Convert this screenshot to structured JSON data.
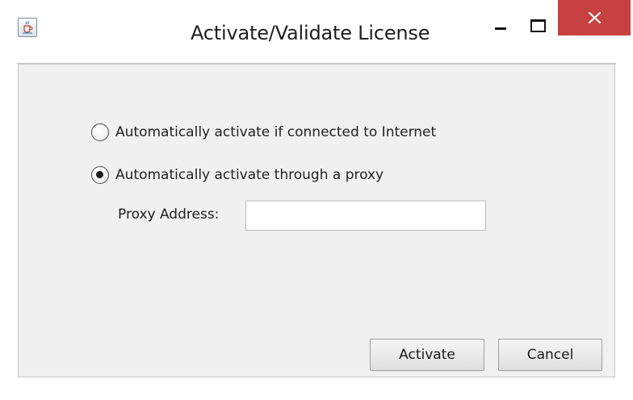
{
  "window": {
    "title": "Activate/Validate License",
    "icon": "java-cup-icon",
    "controls": {
      "minimize": "minimize-icon",
      "maximize": "maximize-icon",
      "close": "close-icon",
      "close_color": "#c74141"
    }
  },
  "activation": {
    "options": [
      {
        "label": "Automatically activate if connected to Internet",
        "selected": false
      },
      {
        "label": "Automatically activate through a proxy",
        "selected": true
      }
    ],
    "proxy": {
      "label": "Proxy Address:",
      "value": ""
    }
  },
  "buttons": {
    "activate": "Activate",
    "cancel": "Cancel"
  }
}
